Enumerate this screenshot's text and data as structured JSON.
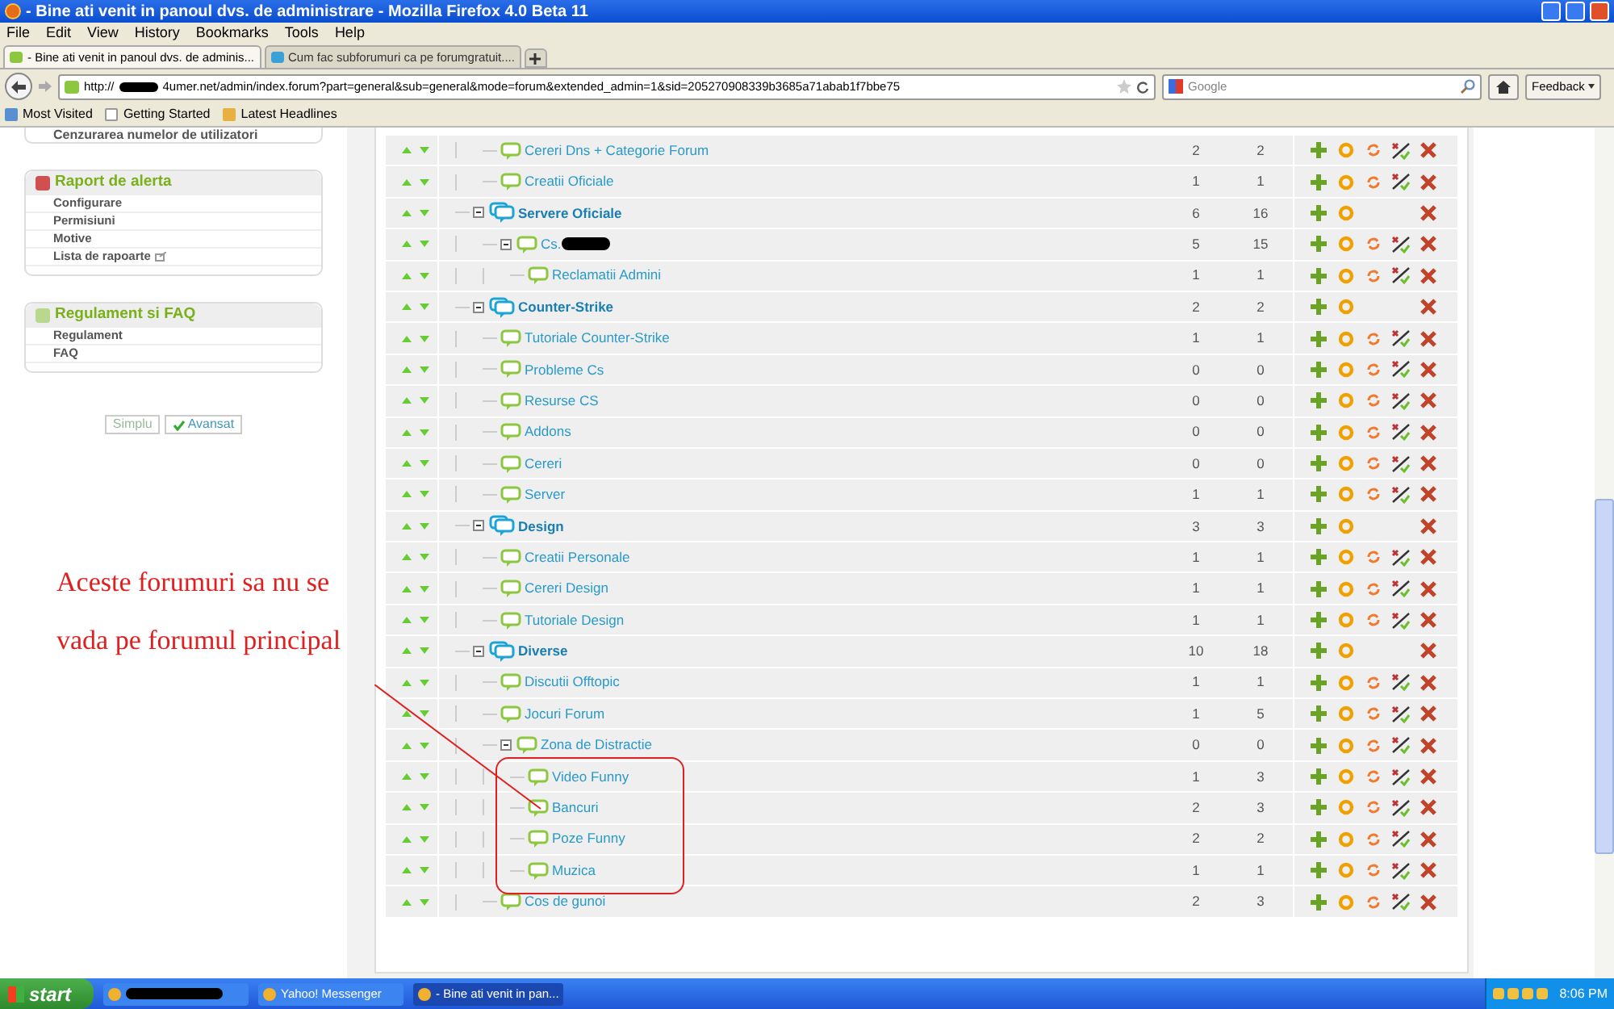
{
  "window": {
    "title": "- Bine ati venit in panoul dvs. de administrare - Mozilla Firefox 4.0 Beta 11"
  },
  "menu": [
    "File",
    "Edit",
    "View",
    "History",
    "Bookmarks",
    "Tools",
    "Help"
  ],
  "tabs": [
    {
      "label": "- Bine ati venit in panoul dvs. de adminis...",
      "selected": true
    },
    {
      "label": "Cum fac subforumuri ca pe forumgratuit....",
      "selected": false
    }
  ],
  "address": {
    "start": "http://",
    "end": "4umer.net/admin/index.forum?part=general&sub=general&mode=forum&extended_admin=1&sid=205270908339b3685a71abab1f7bbe75"
  },
  "search": {
    "placeholder": "Google"
  },
  "feedback": "Feedback",
  "bookmarks": [
    "Most Visited",
    "Getting Started",
    "Latest Headlines"
  ],
  "sidebar": {
    "cut_item": "Cenzurarea numelor de utilizatori",
    "sections": [
      {
        "title": "Raport de alerta",
        "items": [
          {
            "label": "Configurare",
            "external": false
          },
          {
            "label": "Permisiuni",
            "external": false
          },
          {
            "label": "Motive",
            "external": false
          },
          {
            "label": "Lista de rapoarte",
            "external": true
          }
        ]
      },
      {
        "title": "Regulament si FAQ",
        "items": [
          {
            "label": "Regulament",
            "external": false
          },
          {
            "label": "FAQ",
            "external": false
          }
        ]
      }
    ],
    "modes": [
      {
        "label": "Simplu",
        "selected": false
      },
      {
        "label": "Avansat",
        "selected": true
      }
    ]
  },
  "forums": [
    {
      "kind": "forum",
      "name": "Cereri Dns + Categorie Forum",
      "topics": "2",
      "posts": "2"
    },
    {
      "kind": "forum",
      "name": "Creatii Oficiale",
      "topics": "1",
      "posts": "1"
    },
    {
      "kind": "category",
      "name": "Servere Oficiale",
      "topics": "6",
      "posts": "16",
      "expanded": true,
      "children": [
        {
          "kind": "forum",
          "name": "Cs.",
          "redacted": true,
          "topics": "5",
          "posts": "15",
          "expanded": true,
          "children": [
            {
              "kind": "forum",
              "name": "Reclamatii Admini",
              "topics": "1",
              "posts": "1"
            }
          ]
        }
      ]
    },
    {
      "kind": "category",
      "name": "Counter-Strike",
      "topics": "2",
      "posts": "2",
      "expanded": true,
      "children": [
        {
          "kind": "forum",
          "name": "Tutoriale Counter-Strike",
          "topics": "1",
          "posts": "1"
        },
        {
          "kind": "forum",
          "name": "Probleme Cs",
          "topics": "0",
          "posts": "0"
        },
        {
          "kind": "forum",
          "name": "Resurse CS",
          "topics": "0",
          "posts": "0"
        },
        {
          "kind": "forum",
          "name": "Addons",
          "topics": "0",
          "posts": "0"
        },
        {
          "kind": "forum",
          "name": "Cereri",
          "topics": "0",
          "posts": "0"
        },
        {
          "kind": "forum",
          "name": "Server",
          "topics": "1",
          "posts": "1"
        }
      ]
    },
    {
      "kind": "category",
      "name": "Design",
      "topics": "3",
      "posts": "3",
      "expanded": true,
      "children": [
        {
          "kind": "forum",
          "name": "Creatii Personale",
          "topics": "1",
          "posts": "1"
        },
        {
          "kind": "forum",
          "name": "Cereri Design",
          "topics": "1",
          "posts": "1"
        },
        {
          "kind": "forum",
          "name": "Tutoriale Design",
          "topics": "1",
          "posts": "1"
        }
      ]
    },
    {
      "kind": "category",
      "name": "Diverse",
      "topics": "10",
      "posts": "18",
      "expanded": true,
      "children": [
        {
          "kind": "forum",
          "name": "Discutii Offtopic",
          "topics": "1",
          "posts": "1"
        },
        {
          "kind": "forum",
          "name": "Jocuri Forum",
          "topics": "1",
          "posts": "5"
        },
        {
          "kind": "forum",
          "name": "Zona de Distractie",
          "topics": "0",
          "posts": "0",
          "expanded": true,
          "children": [
            {
              "kind": "forum",
              "name": "Video Funny",
              "topics": "1",
              "posts": "3"
            },
            {
              "kind": "forum",
              "name": "Bancuri",
              "topics": "2",
              "posts": "3"
            },
            {
              "kind": "forum",
              "name": "Poze Funny",
              "topics": "2",
              "posts": "2"
            },
            {
              "kind": "forum",
              "name": "Muzica",
              "topics": "1",
              "posts": "1"
            }
          ]
        },
        {
          "kind": "forum",
          "name": "Cos de gunoi",
          "topics": "2",
          "posts": "3"
        }
      ]
    }
  ],
  "annotation": {
    "lines": [
      "Aceste forumuri sa nu se",
      "vada pe forumul principal"
    ]
  },
  "taskbar": {
    "start": "start",
    "items": [
      {
        "redacted": true,
        "selected": false
      },
      {
        "label": "Yahoo! Messenger",
        "selected": false
      },
      {
        "label": "- Bine ati venit in pan...",
        "selected": true
      }
    ],
    "clock": "8:06 PM"
  }
}
